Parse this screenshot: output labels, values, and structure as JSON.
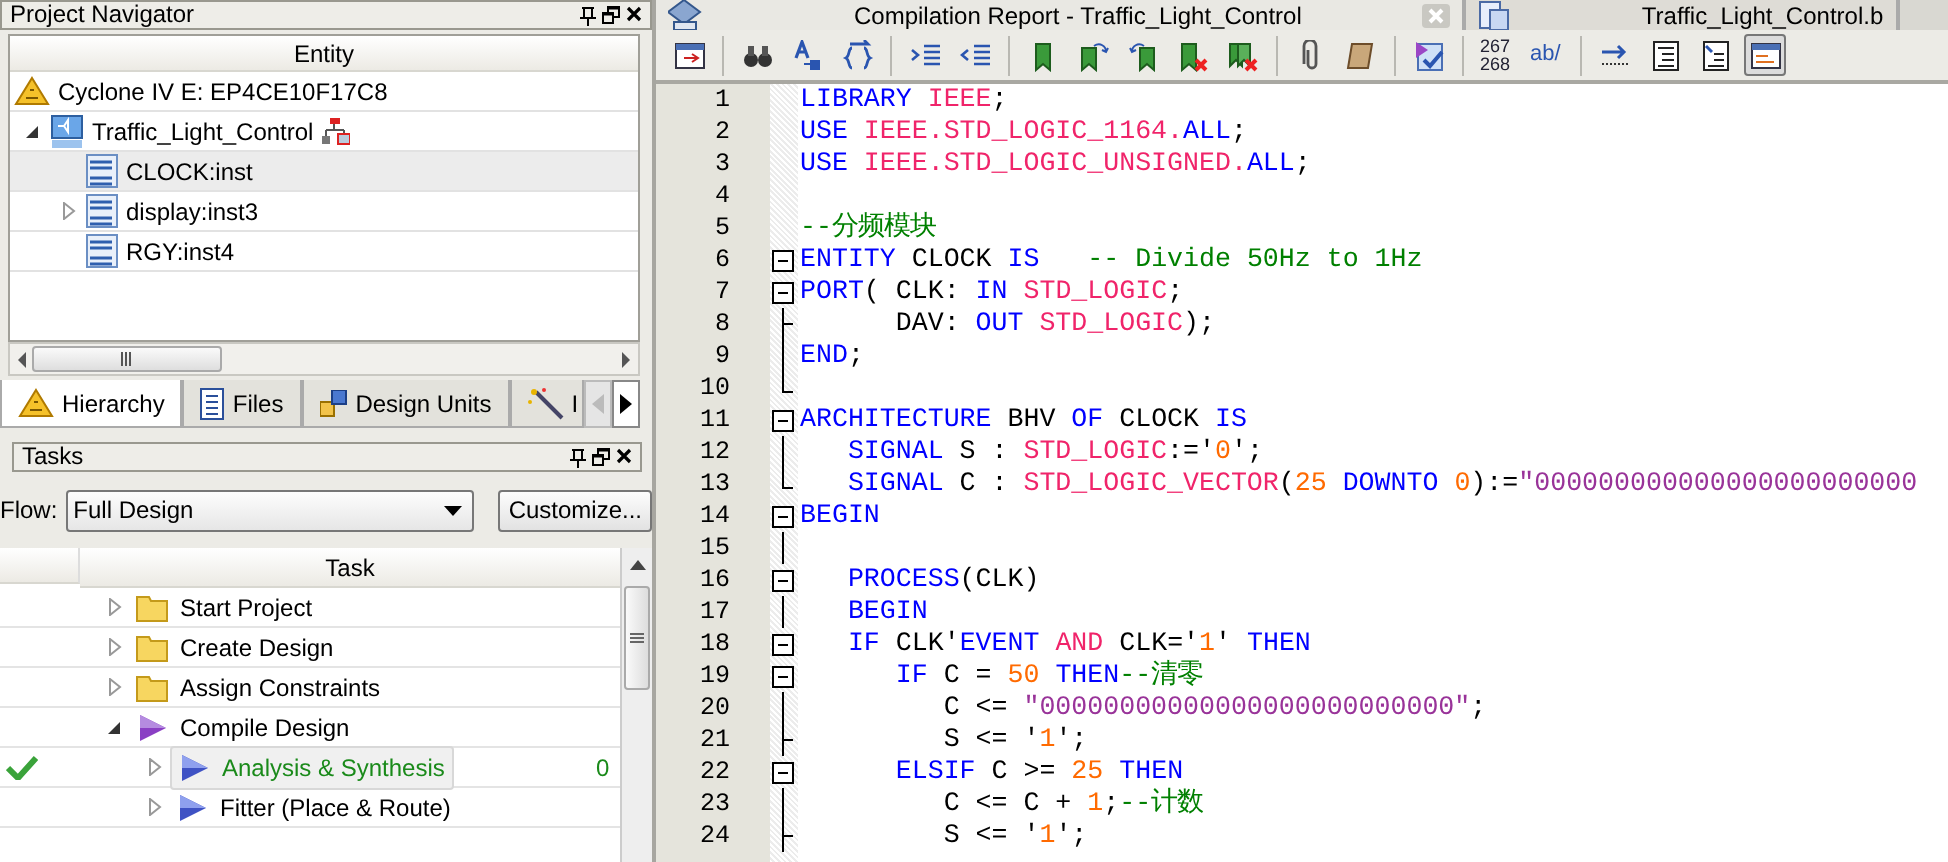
{
  "navigator": {
    "title": "Project Navigator",
    "column": "Entity",
    "device": "Cyclone IV E: EP4CE10F17C8",
    "tree": [
      {
        "label": "Traffic_Light_Control",
        "expanded": true,
        "selected": false,
        "children": [
          {
            "label": "CLOCK:inst",
            "selected": true
          },
          {
            "label": "display:inst3",
            "expanded": false,
            "selected": false
          },
          {
            "label": "RGY:inst4",
            "selected": false
          }
        ]
      }
    ],
    "tabs": [
      {
        "label": "Hierarchy",
        "selected": true
      },
      {
        "label": "Files",
        "selected": false
      },
      {
        "label": "Design Units",
        "selected": false
      },
      {
        "label": "I",
        "selected": false
      }
    ]
  },
  "tasks": {
    "title": "Tasks",
    "flow_label": "Flow:",
    "flow_value": "Full Design",
    "customize": "Customize...",
    "column": "Task",
    "rows": [
      {
        "label": "Start Project",
        "kind": "folder",
        "expanded": false,
        "done": false,
        "selected": false
      },
      {
        "label": "Create Design",
        "kind": "folder",
        "expanded": false,
        "done": false,
        "selected": false
      },
      {
        "label": "Assign Constraints",
        "kind": "folder",
        "expanded": false,
        "done": false,
        "selected": false
      },
      {
        "label": "Compile Design",
        "kind": "flow",
        "expanded": true,
        "done": false,
        "selected": false,
        "children": [
          {
            "label": "Analysis & Synthesis",
            "kind": "flow",
            "expanded": false,
            "done": true,
            "selected": true,
            "column_3": "0"
          },
          {
            "label": "Fitter (Place & Route)",
            "kind": "flow",
            "expanded": false,
            "done": false,
            "selected": false
          }
        ]
      }
    ]
  },
  "editor_tabs": [
    {
      "label": "Compilation Report - Traffic_Light_Control",
      "selected": true
    },
    {
      "label": "Traffic_Light_Control.b",
      "selected": false
    }
  ],
  "toolbar": [
    {
      "kind": "button",
      "selected": false
    },
    {
      "kind": "separator"
    },
    {
      "kind": "button",
      "selected": false
    },
    {
      "kind": "button",
      "selected": false
    },
    {
      "kind": "button",
      "selected": false
    },
    {
      "kind": "separator"
    },
    {
      "kind": "button",
      "selected": false
    },
    {
      "kind": "button",
      "selected": false
    },
    {
      "kind": "separator"
    },
    {
      "kind": "button",
      "selected": false
    },
    {
      "kind": "button",
      "selected": false
    },
    {
      "kind": "button",
      "selected": false
    },
    {
      "kind": "button",
      "selected": false
    },
    {
      "kind": "button",
      "selected": false
    },
    {
      "kind": "separator"
    },
    {
      "kind": "button",
      "selected": false
    },
    {
      "kind": "button",
      "selected": false
    },
    {
      "kind": "separator"
    },
    {
      "kind": "button",
      "selected": false
    },
    {
      "kind": "separator"
    },
    {
      "kind": "text",
      "label": [
        "267",
        "268"
      ],
      "selected": false
    },
    {
      "kind": "text",
      "label": [
        "ab/"
      ],
      "selected": false
    },
    {
      "kind": "separator"
    },
    {
      "kind": "button",
      "selected": false
    },
    {
      "kind": "button",
      "selected": false
    },
    {
      "kind": "button",
      "selected": false
    },
    {
      "kind": "button",
      "selected": true
    }
  ],
  "code": [
    {
      "num": "1",
      "tokens": [
        {
          "text": "LIBRARY ",
          "kind": "keyword"
        },
        {
          "text": "IEEE",
          "kind": "library"
        },
        {
          "text": ";",
          "kind": "plain"
        }
      ]
    },
    {
      "num": "2",
      "tokens": [
        {
          "text": "USE ",
          "kind": "keyword"
        },
        {
          "text": "IEEE.STD_LOGIC_1164.",
          "kind": "library"
        },
        {
          "text": "ALL",
          "kind": "keyword"
        },
        {
          "text": ";",
          "kind": "plain"
        }
      ]
    },
    {
      "num": "3",
      "tokens": [
        {
          "text": "USE ",
          "kind": "keyword"
        },
        {
          "text": "IEEE.STD_LOGIC_UNSIGNED.",
          "kind": "library"
        },
        {
          "text": "ALL",
          "kind": "keyword"
        },
        {
          "text": ";",
          "kind": "plain"
        }
      ]
    },
    {
      "num": "4"
    },
    {
      "num": "5",
      "tokens": [
        {
          "text": "--分频模块",
          "kind": "comment"
        }
      ]
    },
    {
      "num": "6",
      "kind": "box",
      "tokens": [
        {
          "text": "ENTITY ",
          "kind": "keyword"
        },
        {
          "text": "CLOCK ",
          "kind": "plain"
        },
        {
          "text": "IS",
          "kind": "keyword"
        },
        {
          "text": "   -- Divide 50Hz to 1Hz",
          "kind": "comment"
        }
      ]
    },
    {
      "num": "7",
      "kind": "box",
      "tokens": [
        {
          "text": "PORT",
          "kind": "keyword"
        },
        {
          "text": "( CLK: ",
          "kind": "plain"
        },
        {
          "text": "IN ",
          "kind": "keyword"
        },
        {
          "text": "STD_LOGIC",
          "kind": "library"
        },
        {
          "text": ";",
          "kind": "plain"
        }
      ]
    },
    {
      "num": "8",
      "kind": "tee",
      "tokens": [
        {
          "text": "      DAV: ",
          "kind": "plain"
        },
        {
          "text": "OUT ",
          "kind": "keyword"
        },
        {
          "text": "STD_LOGIC",
          "kind": "library"
        },
        {
          "text": ");",
          "kind": "plain"
        }
      ]
    },
    {
      "num": "9",
      "kind": "line",
      "tokens": [
        {
          "text": "END",
          "kind": "keyword"
        },
        {
          "text": ";",
          "kind": "plain"
        }
      ]
    },
    {
      "num": "10",
      "kind": "end"
    },
    {
      "num": "11",
      "kind": "box",
      "tokens": [
        {
          "text": "ARCHITECTURE ",
          "kind": "keyword"
        },
        {
          "text": "BHV ",
          "kind": "plain"
        },
        {
          "text": "OF ",
          "kind": "keyword"
        },
        {
          "text": "CLOCK ",
          "kind": "plain"
        },
        {
          "text": "IS",
          "kind": "keyword"
        }
      ]
    },
    {
      "num": "12",
      "kind": "line",
      "tokens": [
        {
          "text": "   SIGNAL ",
          "kind": "keyword"
        },
        {
          "text": "S : ",
          "kind": "plain"
        },
        {
          "text": "STD_LOGIC",
          "kind": "library"
        },
        {
          "text": ":='",
          "kind": "plain"
        },
        {
          "text": "0",
          "kind": "number"
        },
        {
          "text": "';",
          "kind": "plain"
        }
      ]
    },
    {
      "num": "13",
      "kind": "end",
      "tokens": [
        {
          "text": "   SIGNAL ",
          "kind": "keyword"
        },
        {
          "text": "C : ",
          "kind": "plain"
        },
        {
          "text": "STD_LOGIC_VECTOR",
          "kind": "library"
        },
        {
          "text": "(",
          "kind": "plain"
        },
        {
          "text": "25 ",
          "kind": "number"
        },
        {
          "text": "DOWNTO ",
          "kind": "keyword"
        },
        {
          "text": "0",
          "kind": "number"
        },
        {
          "text": "):=",
          "kind": "plain"
        },
        {
          "text": "\"000000000000000000000000",
          "kind": "string"
        }
      ]
    },
    {
      "num": "14",
      "kind": "box",
      "tokens": [
        {
          "text": "BEGIN",
          "kind": "keyword"
        }
      ]
    },
    {
      "num": "15",
      "kind": "line"
    },
    {
      "num": "16",
      "kind": "box",
      "tokens": [
        {
          "text": "   PROCESS",
          "kind": "keyword"
        },
        {
          "text": "(CLK)",
          "kind": "plain"
        }
      ]
    },
    {
      "num": "17",
      "kind": "line",
      "tokens": [
        {
          "text": "   BEGIN",
          "kind": "keyword"
        }
      ]
    },
    {
      "num": "18",
      "kind": "box",
      "tokens": [
        {
          "text": "   IF ",
          "kind": "keyword"
        },
        {
          "text": "CLK'",
          "kind": "plain"
        },
        {
          "text": "EVENT ",
          "kind": "keyword"
        },
        {
          "text": "AND ",
          "kind": "library"
        },
        {
          "text": "CLK='",
          "kind": "plain"
        },
        {
          "text": "1",
          "kind": "number"
        },
        {
          "text": "' ",
          "kind": "plain"
        },
        {
          "text": "THEN",
          "kind": "keyword"
        }
      ]
    },
    {
      "num": "19",
      "kind": "box",
      "tokens": [
        {
          "text": "      IF ",
          "kind": "keyword"
        },
        {
          "text": "C = ",
          "kind": "plain"
        },
        {
          "text": "50 ",
          "kind": "number"
        },
        {
          "text": "THEN",
          "kind": "keyword"
        },
        {
          "text": "--清零",
          "kind": "comment"
        }
      ]
    },
    {
      "num": "20",
      "kind": "line",
      "tokens": [
        {
          "text": "         C <= ",
          "kind": "plain"
        },
        {
          "text": "\"00000000000000000000000000\"",
          "kind": "string"
        },
        {
          "text": ";",
          "kind": "plain"
        }
      ]
    },
    {
      "num": "21",
      "kind": "tee",
      "tokens": [
        {
          "text": "         S <= '",
          "kind": "plain"
        },
        {
          "text": "1",
          "kind": "number"
        },
        {
          "text": "';",
          "kind": "plain"
        }
      ]
    },
    {
      "num": "22",
      "kind": "box",
      "tokens": [
        {
          "text": "      ELSIF ",
          "kind": "keyword"
        },
        {
          "text": "C >= ",
          "kind": "plain"
        },
        {
          "text": "25 ",
          "kind": "number"
        },
        {
          "text": "THEN",
          "kind": "keyword"
        }
      ]
    },
    {
      "num": "23",
      "kind": "line",
      "tokens": [
        {
          "text": "         C <= C + ",
          "kind": "plain"
        },
        {
          "text": "1",
          "kind": "number"
        },
        {
          "text": ";",
          "kind": "plain"
        },
        {
          "text": "--计数",
          "kind": "comment"
        }
      ]
    },
    {
      "num": "24",
      "kind": "tee",
      "tokens": [
        {
          "text": "         S <= '",
          "kind": "plain"
        },
        {
          "text": "1",
          "kind": "number"
        },
        {
          "text": "';",
          "kind": "plain"
        }
      ]
    }
  ]
}
